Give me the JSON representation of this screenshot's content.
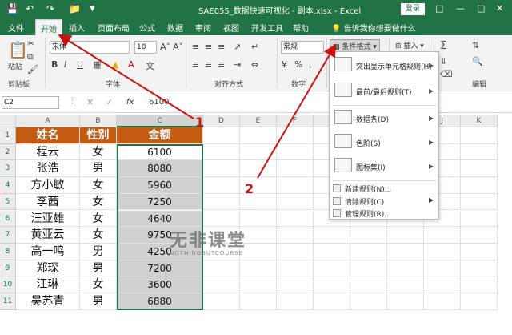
{
  "window": {
    "title": "SAE055_数据快速可视化 - 副本.xlsx  -  Excel",
    "login_button": "登录"
  },
  "tabs": [
    "文件",
    "开始",
    "插入",
    "页面布局",
    "公式",
    "数据",
    "审阅",
    "视图",
    "开发工具",
    "帮助"
  ],
  "active_tab": "开始",
  "tell_me": "告诉我你想要做什么",
  "ribbon": {
    "paste": "粘贴",
    "clipboard_label": "剪贴板",
    "font_name": "宋体",
    "font_size": "18",
    "font_label": "字体",
    "align_label": "对齐方式",
    "number_format": "常规",
    "number_label": "数字",
    "conditional_format": "条件格式",
    "insert": "插入",
    "edit_label": "编辑"
  },
  "formula_bar": {
    "name_box": "C2",
    "fx": "fx",
    "value": "6100"
  },
  "columns": [
    "A",
    "B",
    "C",
    "D",
    "E",
    "F",
    "G",
    "H",
    "I",
    "J",
    "K"
  ],
  "rows": [
    "1",
    "2",
    "3",
    "4",
    "5",
    "6",
    "7",
    "8",
    "9",
    "10",
    "11"
  ],
  "table": {
    "headers": [
      "姓名",
      "性别",
      "金额"
    ],
    "rows": [
      [
        "程云",
        "女",
        "6100"
      ],
      [
        "张浩",
        "男",
        "8080"
      ],
      [
        "方小敏",
        "女",
        "5960"
      ],
      [
        "李茜",
        "女",
        "7250"
      ],
      [
        "汪亚雄",
        "女",
        "4640"
      ],
      [
        "黄亚云",
        "女",
        "9750"
      ],
      [
        "高一鸣",
        "男",
        "4250"
      ],
      [
        "郑琛",
        "男",
        "7200"
      ],
      [
        "江琳",
        "女",
        "3600"
      ],
      [
        "吴苏青",
        "男",
        "6880"
      ]
    ]
  },
  "dropdown": {
    "items": [
      {
        "label": "突出显示单元格规则(H)",
        "icon": "highlight-cells-icon"
      },
      {
        "label": "最前/最后规则(T)",
        "icon": "top-bottom-icon"
      },
      {
        "label": "数据条(D)",
        "icon": "data-bars-icon"
      },
      {
        "label": "色阶(S)",
        "icon": "color-scales-icon"
      },
      {
        "label": "图标集(I)",
        "icon": "icon-sets-icon"
      }
    ],
    "small_items": [
      "新建规则(N)...",
      "清除规则(C)",
      "管理规则(R)..."
    ]
  },
  "annotations": [
    "1",
    "2"
  ],
  "watermark": {
    "main": "无非课堂",
    "sub": "NOTHINGBUTCOURSE"
  },
  "colors": {
    "excel_green": "#217346",
    "header_fill": "#c55a11",
    "arrow_red": "#d01010"
  }
}
